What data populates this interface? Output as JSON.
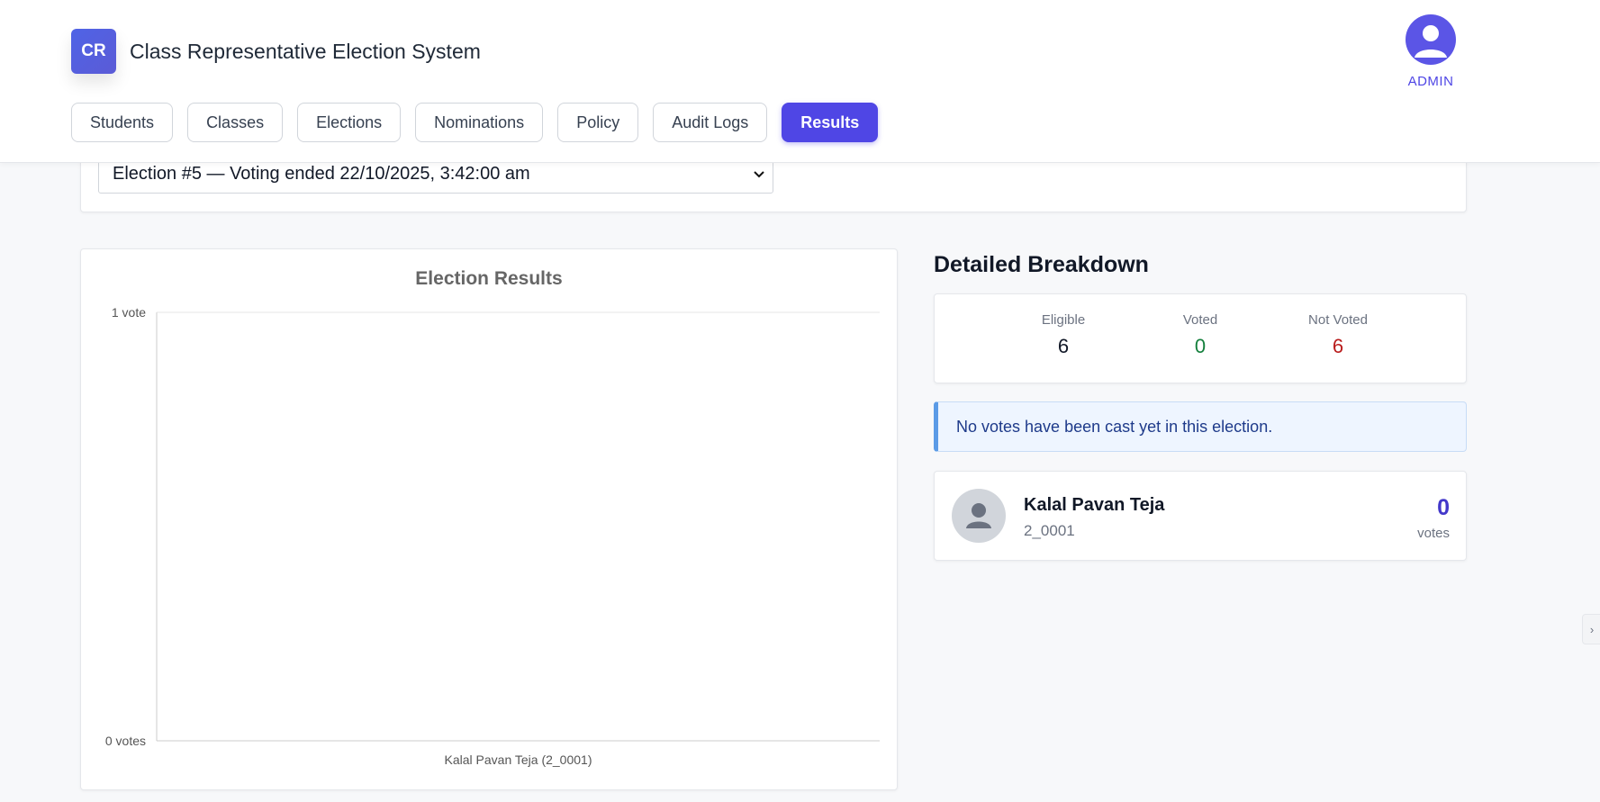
{
  "header": {
    "logo_text": "CR",
    "title": "Class Representative Election System",
    "user_label": "ADMIN"
  },
  "nav": {
    "items": [
      {
        "label": "Students"
      },
      {
        "label": "Classes"
      },
      {
        "label": "Elections"
      },
      {
        "label": "Nominations"
      },
      {
        "label": "Policy"
      },
      {
        "label": "Audit Logs"
      },
      {
        "label": "Results",
        "active": true
      }
    ]
  },
  "election_select": {
    "selected": "Election #5 — Voting ended 22/10/2025, 3:42:00 am"
  },
  "chart_data": {
    "type": "bar",
    "title": "Election Results",
    "categories": [
      "Kalal Pavan Teja  (2_0001)"
    ],
    "values": [
      0
    ],
    "ylim": [
      0,
      1
    ],
    "yticks": [
      "0 votes",
      "1 vote"
    ],
    "grid": true
  },
  "breakdown": {
    "title": "Detailed Breakdown",
    "stats": [
      {
        "label": "Eligible",
        "value": "6",
        "color": "#111827"
      },
      {
        "label": "Voted",
        "value": "0",
        "color": "#15803d"
      },
      {
        "label": "Not Voted",
        "value": "6",
        "color": "#b91c1c"
      }
    ],
    "alert": "No votes have been cast yet in this election.",
    "candidates": [
      {
        "name": "Kalal Pavan Teja",
        "id": "2_0001",
        "votes": "0",
        "votes_label": "votes"
      }
    ]
  },
  "icons": {
    "admin_avatar": "user-icon",
    "candidate_avatar": "user-icon",
    "select_chevron": "chevron-down-icon",
    "side_handle": "chevron-right-icon"
  },
  "colors": {
    "accent": "#4f46e5",
    "voted": "#15803d",
    "not_voted": "#b91c1c",
    "alert_border": "#5b9be6"
  }
}
